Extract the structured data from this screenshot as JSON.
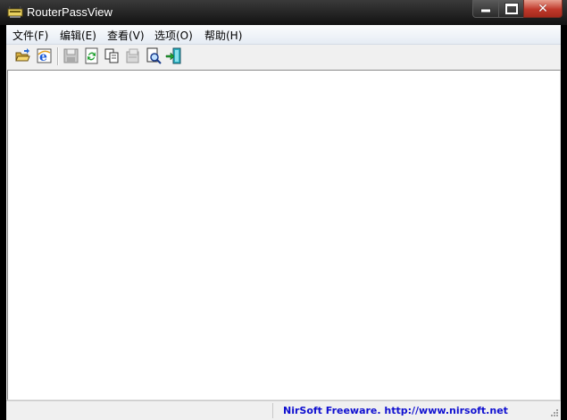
{
  "window": {
    "title": "RouterPassView"
  },
  "menu": {
    "items": [
      {
        "label": "文件(F)"
      },
      {
        "label": "编辑(E)"
      },
      {
        "label": "查看(V)"
      },
      {
        "label": "选项(O)"
      },
      {
        "label": "帮助(H)"
      }
    ]
  },
  "toolbar": {
    "icons": [
      "open-folder-icon",
      "internet-explorer-icon",
      "save-icon",
      "refresh-icon",
      "copy-icon",
      "properties-icon",
      "find-icon",
      "exit-icon"
    ]
  },
  "statusbar": {
    "left_text": "",
    "link_text": "NirSoft Freeware.  http://www.nirsoft.net"
  },
  "colors": {
    "link": "#1010d0",
    "close_button": "#c0392b"
  }
}
